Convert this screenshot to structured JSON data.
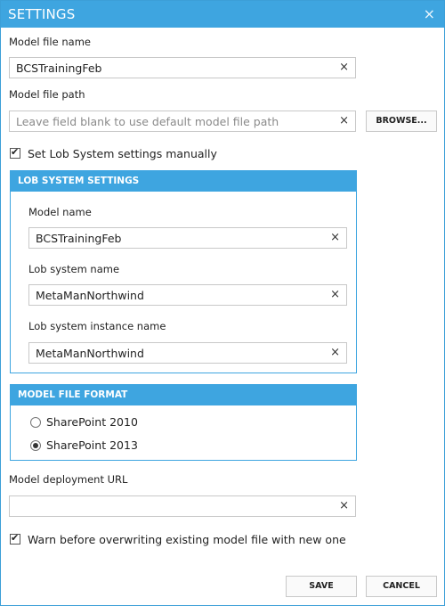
{
  "dialog": {
    "title": "SETTINGS",
    "close_icon": "×"
  },
  "model_file_name": {
    "label": "Model file name",
    "value": "BCSTrainingFeb"
  },
  "model_file_path": {
    "label": "Model file path",
    "value": "",
    "placeholder": "Leave field blank to use default model file path",
    "browse_label": "BROWSE..."
  },
  "set_lob_manually": {
    "label": "Set Lob System settings manually",
    "checked": true
  },
  "lob_settings": {
    "header": "LOB SYSTEM SETTINGS",
    "model_name": {
      "label": "Model name",
      "value": "BCSTrainingFeb"
    },
    "lob_system_name": {
      "label": "Lob system name",
      "value": "MetaManNorthwind"
    },
    "lob_instance_name": {
      "label": "Lob system instance name",
      "value": "MetaManNorthwind"
    }
  },
  "model_file_format": {
    "header": "MODEL FILE FORMAT",
    "options": [
      {
        "label": "SharePoint 2010",
        "selected": false
      },
      {
        "label": "SharePoint 2013",
        "selected": true
      }
    ]
  },
  "deployment_url": {
    "label": "Model deployment URL",
    "value": ""
  },
  "warn_overwrite": {
    "label": "Warn before overwriting existing model file with new one",
    "checked": true
  },
  "footer": {
    "save_label": "SAVE",
    "cancel_label": "CANCEL"
  },
  "icons": {
    "clear": "×",
    "check": "✔"
  }
}
